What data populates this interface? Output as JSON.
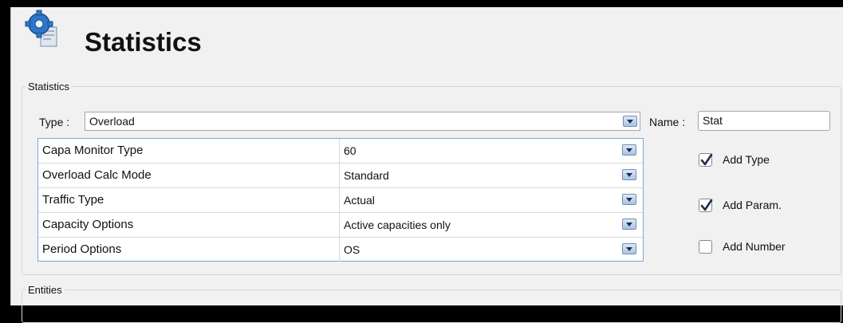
{
  "title": "Statistics",
  "statistics_group": {
    "legend": "Statistics",
    "type_label": "Type :",
    "type_value": "Overload",
    "name_label": "Name :",
    "name_value": "Stat"
  },
  "params": [
    {
      "name": "Capa Monitor Type",
      "value": "60"
    },
    {
      "name": "Overload Calc Mode",
      "value": "Standard"
    },
    {
      "name": "Traffic Type",
      "value": "Actual"
    },
    {
      "name": "Capacity Options",
      "value": "Active capacities only"
    },
    {
      "name": "Period Options",
      "value": "OS"
    }
  ],
  "options": [
    {
      "label": "Add Type",
      "checked": true
    },
    {
      "label": "Add Param.",
      "checked": true
    },
    {
      "label": "Add Number",
      "checked": false
    }
  ],
  "entities_group": {
    "legend": "Entities"
  },
  "icons": {
    "title": "statistics-gear-icon",
    "dropdown": "chevron-down-icon",
    "check": "checkmark-icon"
  },
  "colors": {
    "checkmark": "#1a2f4d",
    "grid_border": "#7aa7d6",
    "dropdown_fill": "#bcd3ee"
  }
}
